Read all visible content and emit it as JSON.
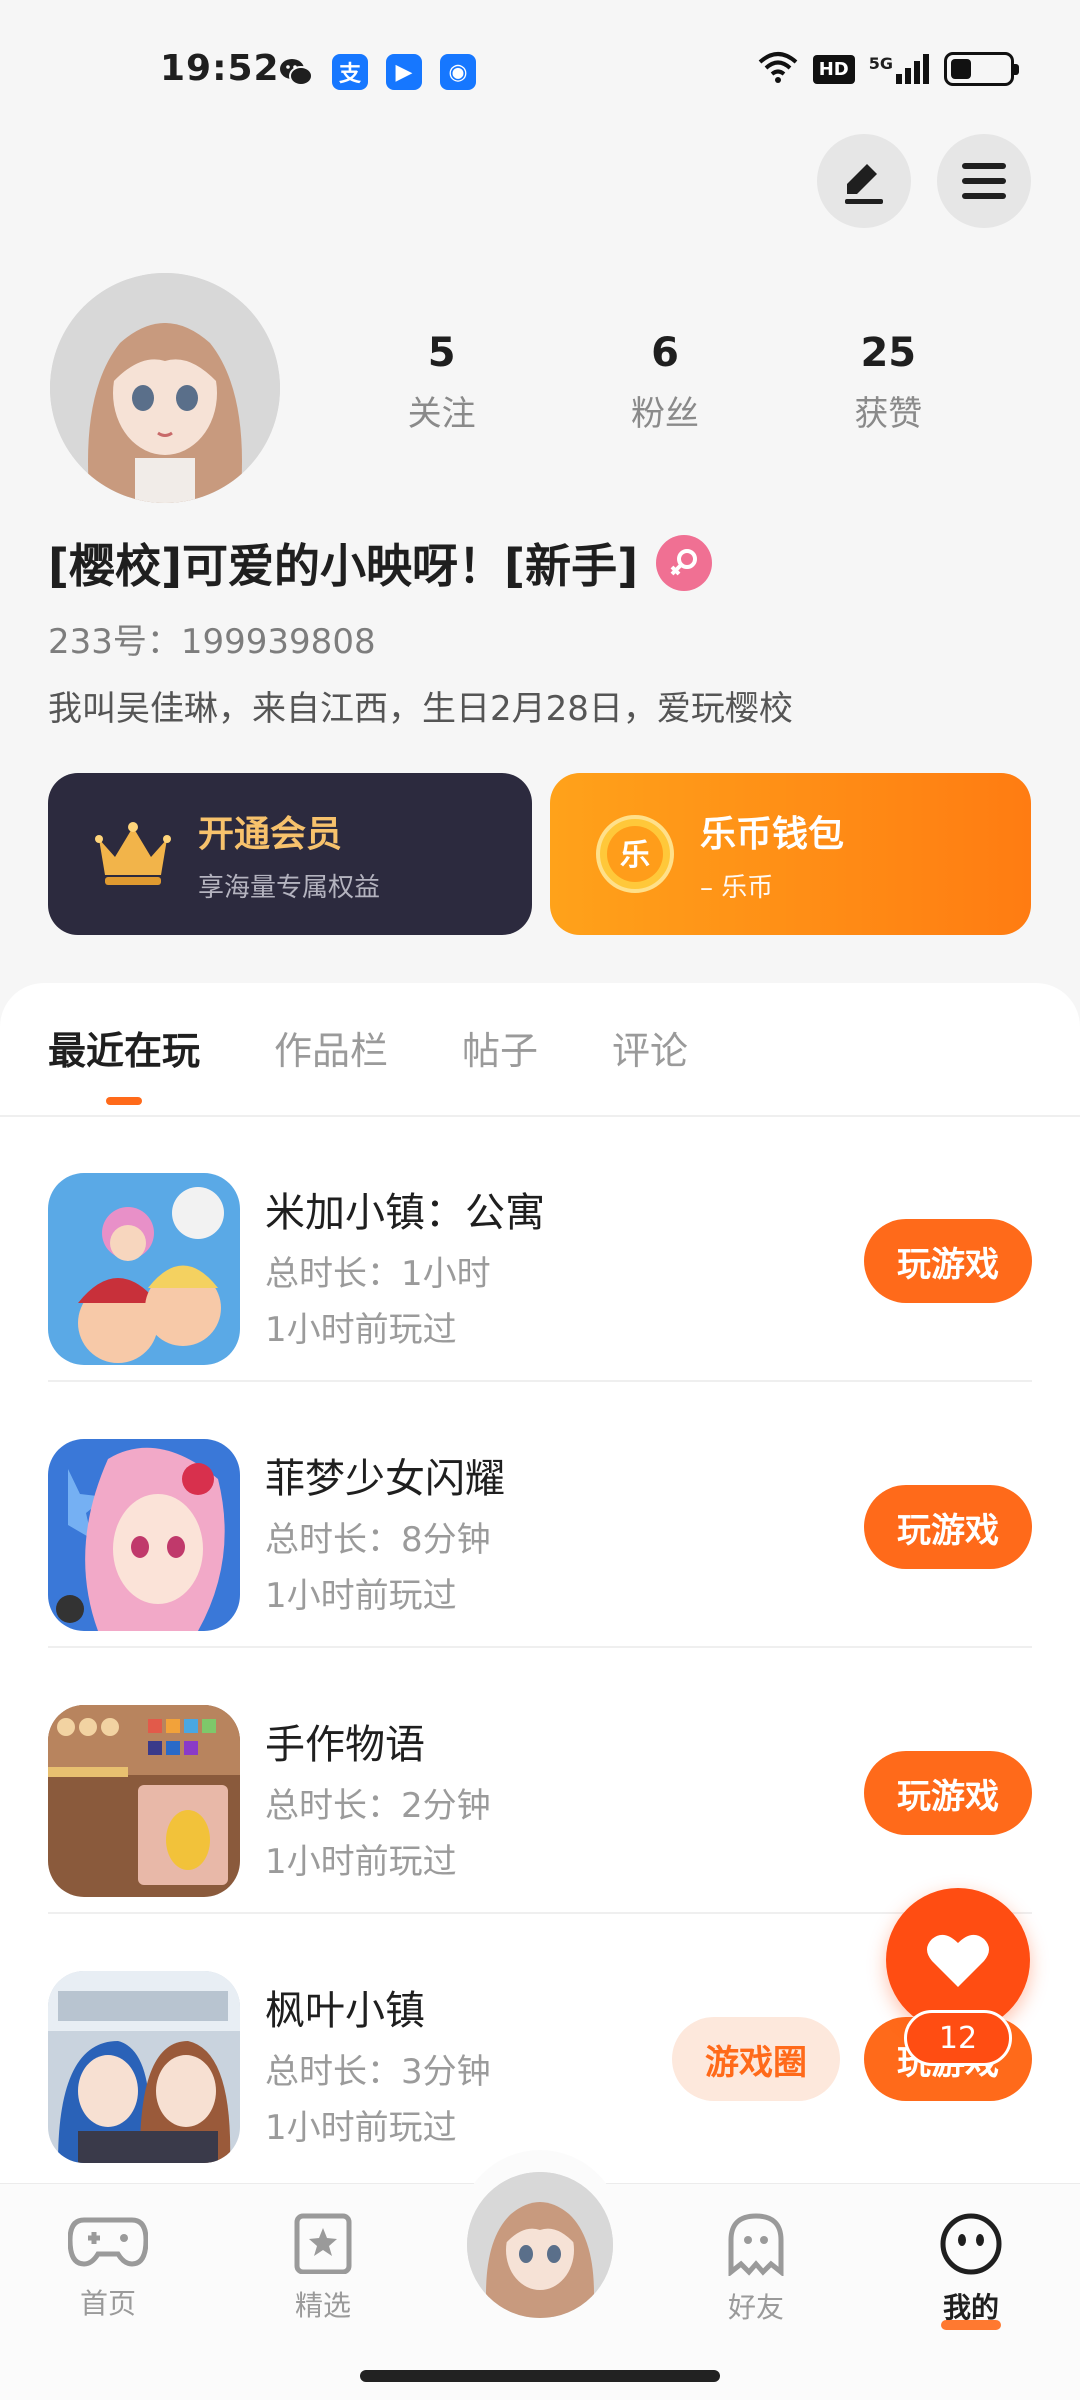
{
  "status_bar": {
    "time": "19:52",
    "apps": [
      {
        "name": "wechat-icon",
        "color": "#1f1f1f",
        "glyph": ""
      },
      {
        "name": "alipay-icon",
        "color": "#1677ff",
        "glyph": "支"
      },
      {
        "name": "app-icon",
        "color": "#1677ff",
        "glyph": "▶"
      },
      {
        "name": "shield-app-icon",
        "color": "#1677ff",
        "glyph": "◉"
      }
    ],
    "hd": "HD",
    "network": "5G",
    "battery_level": 0.28
  },
  "profile": {
    "stats": [
      {
        "value": "5",
        "label": "关注"
      },
      {
        "value": "6",
        "label": "粉丝"
      },
      {
        "value": "25",
        "label": "获赞"
      }
    ],
    "nickname": "[樱校]可爱的小映呀！[新手]",
    "gender": "female",
    "uid": "233号：199939808",
    "bio": "我叫吴佳琳，来自江西，生日2月28日，爱玩樱校"
  },
  "cards": {
    "vip": {
      "title": "开通会员",
      "subtitle": "享海量专属权益"
    },
    "wallet": {
      "title": "乐币钱包",
      "subtitle": "– 乐币",
      "coin_glyph": "乐"
    }
  },
  "tabs": [
    {
      "label": "最近在玩",
      "active": true
    },
    {
      "label": "作品栏",
      "active": false
    },
    {
      "label": "帖子",
      "active": false
    },
    {
      "label": "评论",
      "active": false
    }
  ],
  "games": [
    {
      "name": "米加小镇：公寓",
      "duration": "总时长：1小时",
      "last_played": "1小时前玩过",
      "button": "玩游戏"
    },
    {
      "name": "菲梦少女闪耀",
      "duration": "总时长：8分钟",
      "last_played": "1小时前玩过",
      "button": "玩游戏"
    },
    {
      "name": "手作物语",
      "duration": "总时长：2分钟",
      "last_played": "1小时前玩过",
      "button": "玩游戏"
    },
    {
      "name": "枫叶小镇",
      "duration": "总时长：3分钟",
      "last_played": "1小时前玩过",
      "button": "玩游戏",
      "extra_button": "游戏圈"
    }
  ],
  "floating": {
    "like_count": "12"
  },
  "bottom_nav": [
    {
      "label": "首页",
      "icon": "gamepad-icon"
    },
    {
      "label": "精选",
      "icon": "star-bookmark-icon"
    },
    {
      "label": "好友",
      "icon": "ghost-icon"
    },
    {
      "label": "我的",
      "icon": "smiley-icon",
      "active": true
    }
  ],
  "colors": {
    "accent": "#ff6a1a",
    "vip_bg": "#2c2a3e",
    "vip_gold": "#f7c26c",
    "wallet_orange": "#ff8c14",
    "gender_pink": "#f07093"
  }
}
